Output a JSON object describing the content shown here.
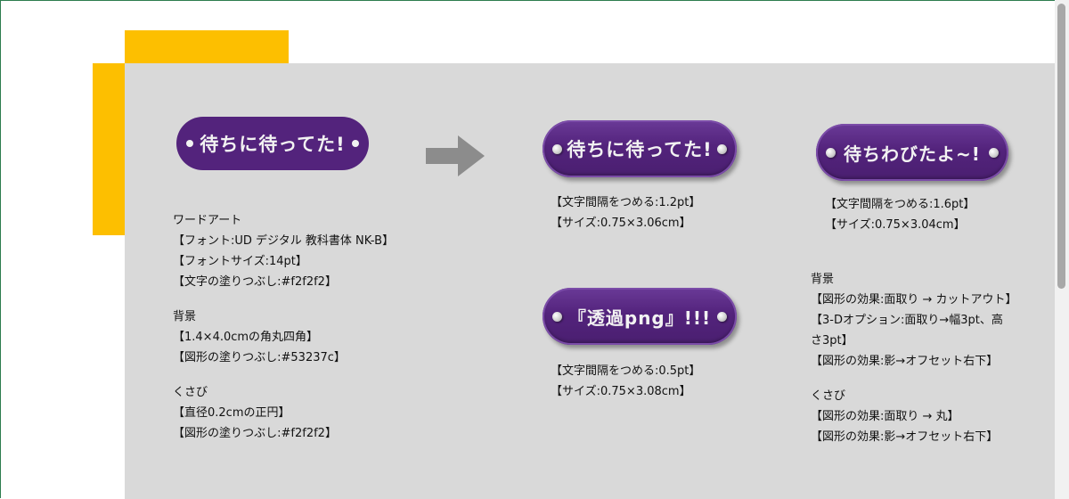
{
  "pills": {
    "original": "待ちに待ってた!",
    "bevel_a": "待ちに待ってた!",
    "bevel_b": "待ちわびたよ~!",
    "bevel_c": "『透過png』!!!"
  },
  "left_notes": {
    "wordart_title": "ワードアート",
    "wordart_font": "【フォント:UD デジタル 教科書体 NK-B】",
    "wordart_size": "【フォントサイズ:14pt】",
    "wordart_fill": "【文字の塗りつぶし:#f2f2f2】",
    "bg_title": "背景",
    "bg_shape": "【1.4×4.0cmの角丸四角】",
    "bg_fill": "【図形の塗りつぶし:#53237c】",
    "wedge_title": "くさび",
    "wedge_shape": "【直径0.2cmの正円】",
    "wedge_fill": "【図形の塗りつぶし:#f2f2f2】"
  },
  "mid_notes_a": {
    "spacing": "【文字間隔をつめる:1.2pt】",
    "size": "【サイズ:0.75×3.06cm】"
  },
  "mid_notes_b": {
    "spacing": "【文字間隔をつめる:0.5pt】",
    "size": "【サイズ:0.75×3.08cm】"
  },
  "right_notes": {
    "spacing": "【文字間隔をつめる:1.6pt】",
    "size": "【サイズ:0.75×3.04cm】",
    "bg_title": "背景",
    "bg_effect": "【図形の効果:面取り → カットアウト】",
    "bg_3d_1": "【3-Dオプション:面取り→幅3pt、高",
    "bg_3d_2": "さ3pt】",
    "bg_shadow": "【図形の効果:影→オフセット右下】",
    "wedge_title": "くさび",
    "wedge_effect": "【図形の効果:面取り → 丸】",
    "wedge_shadow": "【図形の効果:影→オフセット右下】"
  },
  "colors": {
    "pill": "#53237c",
    "text": "#f2f2f2",
    "accent": "#fdbf00",
    "panel": "#d9d9d9",
    "arrow": "#8c8c8c"
  }
}
